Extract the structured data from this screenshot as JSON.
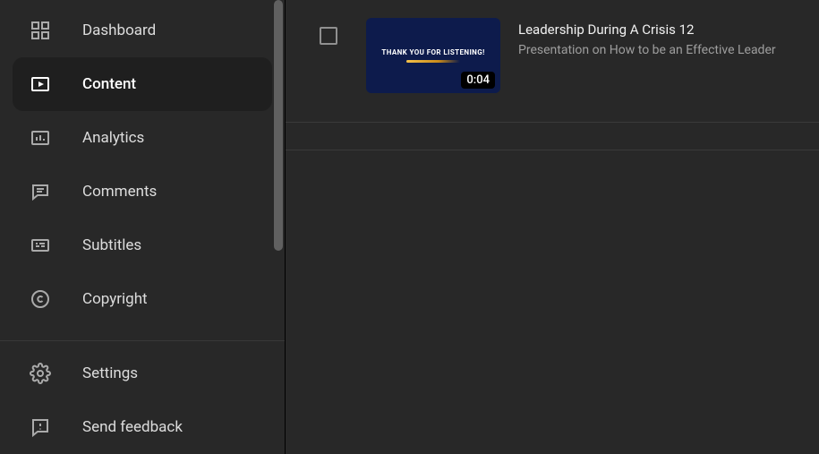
{
  "sidebar": {
    "items": [
      {
        "label": "Dashboard"
      },
      {
        "label": "Content"
      },
      {
        "label": "Analytics"
      },
      {
        "label": "Comments"
      },
      {
        "label": "Subtitles"
      },
      {
        "label": "Copyright"
      }
    ],
    "bottom": [
      {
        "label": "Settings"
      },
      {
        "label": "Send feedback"
      }
    ]
  },
  "video": {
    "title": "Leadership During A Crisis 12",
    "description": "Presentation on How to be an Effective Leader",
    "duration": "0:04",
    "thumb_text": "THANK YOU FOR LISTENING!"
  }
}
